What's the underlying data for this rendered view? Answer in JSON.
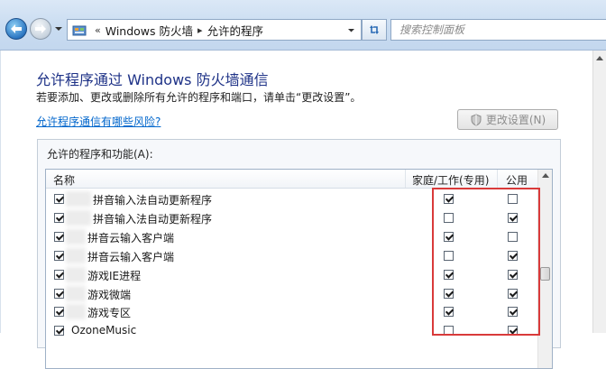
{
  "nav": {
    "breadcrumb": [
      "Windows 防火墙",
      "允许的程序"
    ],
    "breadcrumb_prefix": "«",
    "search_placeholder": "搜索控制面板",
    "icons": {
      "back": "back-arrow-icon",
      "forward": "forward-arrow-icon",
      "recent": "chevron-down-icon",
      "location": "control-panel-icon",
      "refresh": "refresh-icon"
    }
  },
  "page": {
    "title": "允许程序通过 Windows 防火墙通信",
    "description": "若要添加、更改或删除所有允许的程序和端口，请单击“更改设置”。",
    "help_link": "允许程序通信有哪些风险?",
    "change_settings_button": "更改设置(N)"
  },
  "list": {
    "group_label": "允许的程序和功能(A):",
    "columns": [
      "名称",
      "家庭/工作(专用)",
      "公用"
    ],
    "rows": [
      {
        "name": "拼音输入法自动更新程序",
        "enabled": true,
        "private": true,
        "public": false
      },
      {
        "name": "拼音输入法自动更新程序",
        "enabled": true,
        "private": false,
        "public": true
      },
      {
        "name": "拼音云输入客户端",
        "enabled": true,
        "private": true,
        "public": false
      },
      {
        "name": "拼音云输入客户端",
        "enabled": true,
        "private": false,
        "public": true
      },
      {
        "name": "游戏IE进程",
        "enabled": true,
        "private": true,
        "public": true
      },
      {
        "name": "游戏微端",
        "enabled": true,
        "private": true,
        "public": true
      },
      {
        "name": "游戏专区",
        "enabled": true,
        "private": true,
        "public": true
      },
      {
        "name": "OzoneMusic",
        "enabled": true,
        "private": false,
        "public": true
      }
    ]
  },
  "colors": {
    "title": "#1e3287",
    "link": "#0066cc",
    "highlight": "#d93a3a"
  }
}
